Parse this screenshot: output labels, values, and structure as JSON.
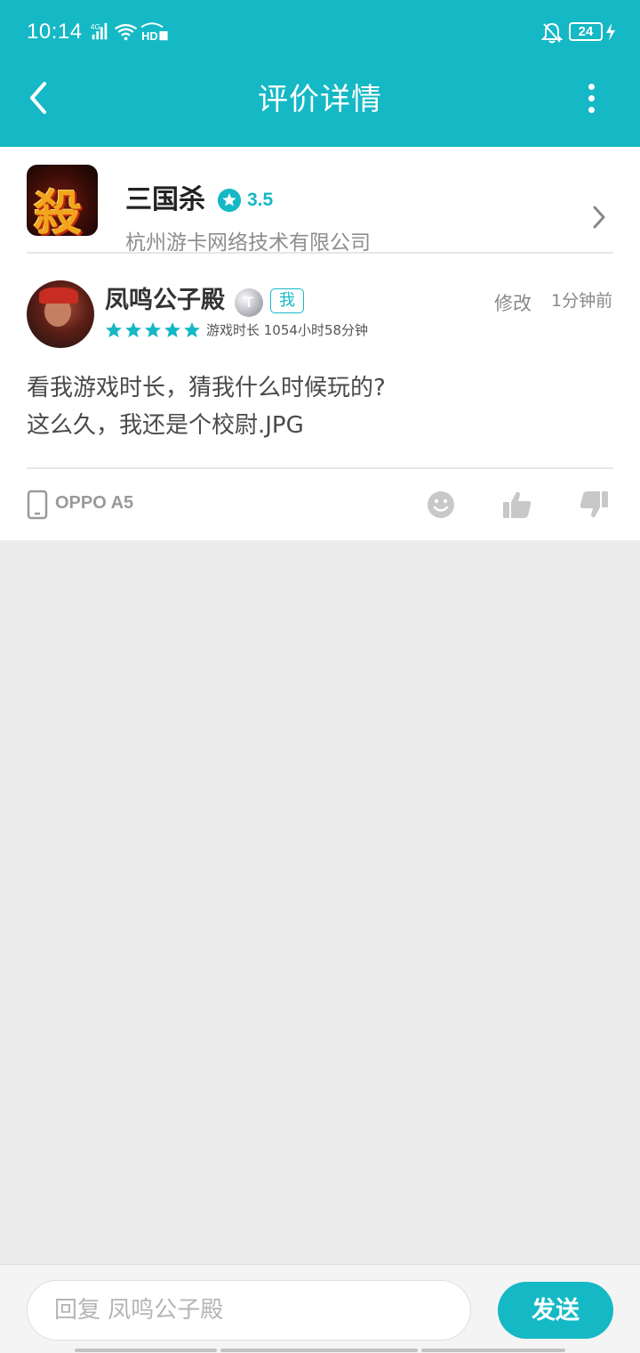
{
  "status_bar": {
    "time": "10:14",
    "network": "4G",
    "hd_label": "HD",
    "battery": "24"
  },
  "header": {
    "title": "评价详情",
    "back_icon": "arrow-left-icon",
    "more_icon": "more-vertical-icon",
    "color": "#15b8c5"
  },
  "app": {
    "name": "三国杀",
    "rating": "3.5",
    "developer": "杭州游卡网络技术有限公司",
    "icon_glyph": "殺"
  },
  "review": {
    "username": "凤鸣公子殿",
    "level_badge": "T",
    "me_tag": "我",
    "edit_label": "修改",
    "time_ago": "1分钟前",
    "stars": 5,
    "playtime": "游戏时长 1054小时58分钟",
    "text_lines": [
      "看我游戏时长，猜我什么时候玩的?",
      "这么久，我还是个校尉.JPG"
    ]
  },
  "device": {
    "name": "OPPO A5"
  },
  "reply": {
    "placeholder": "回复 凤鸣公子殿",
    "send_label": "发送"
  }
}
